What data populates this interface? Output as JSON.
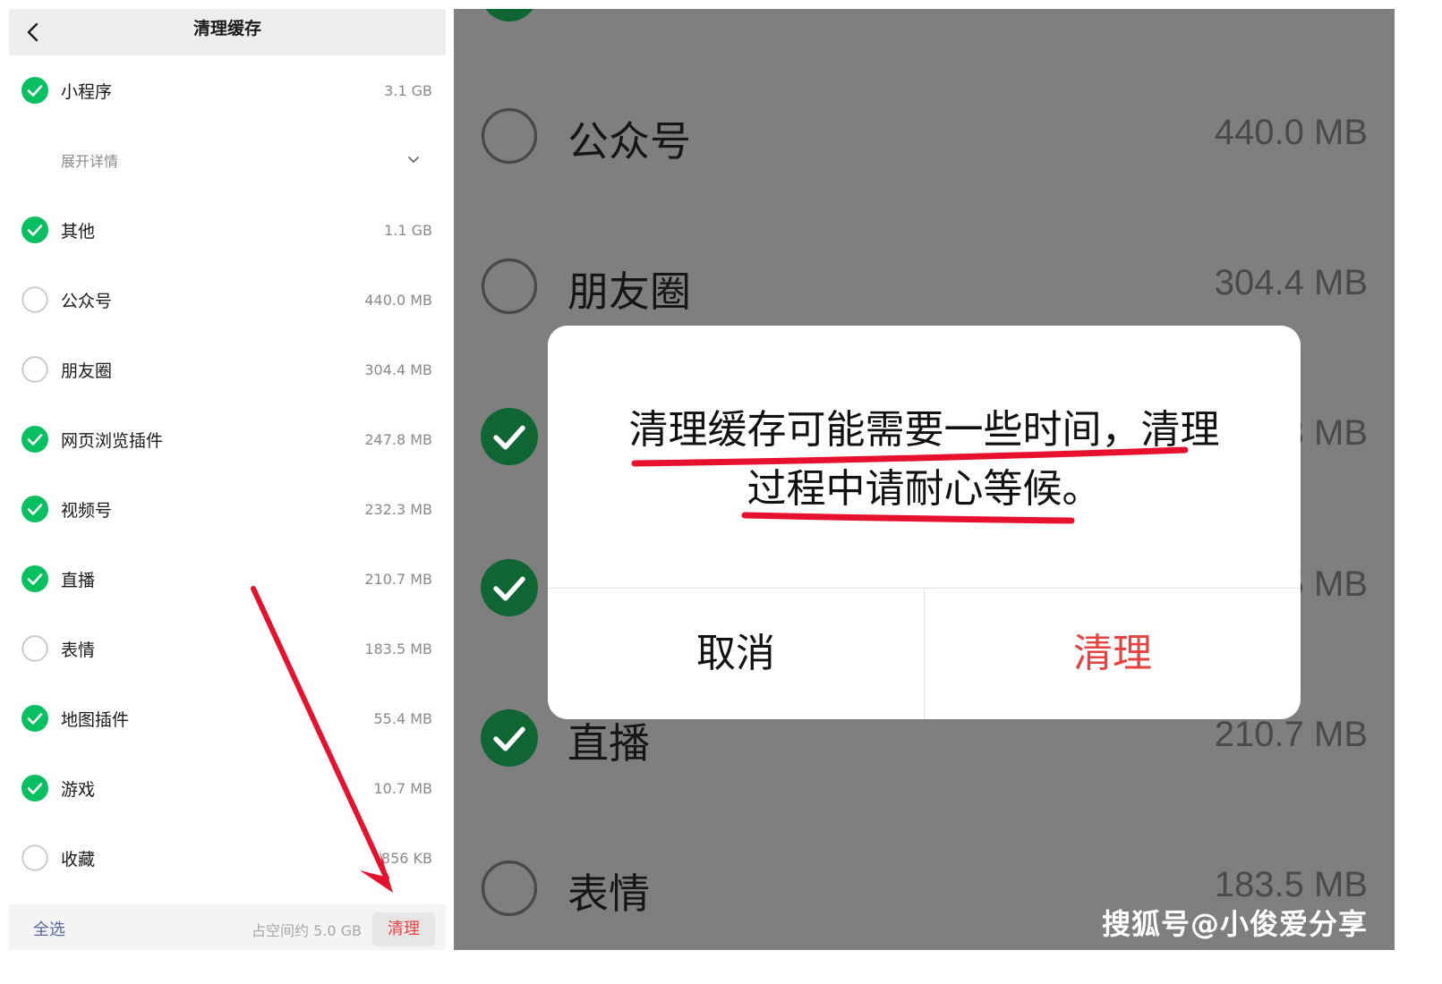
{
  "colors": {
    "check_green": "#07c160",
    "dim_check_green": "#0f6633",
    "accent_red": "#e64340",
    "link_blue": "#57699c",
    "overlay_gray": "#7f7f7f",
    "annotation_red": "#e8112d"
  },
  "left": {
    "title": "清理缓存",
    "back_icon": "chevron-left-icon",
    "expand_label": "展开详情",
    "items": [
      {
        "label": "小程序",
        "size": "3.1 GB",
        "checked": true
      },
      {
        "label": "其他",
        "size": "1.1 GB",
        "checked": true
      },
      {
        "label": "公众号",
        "size": "440.0 MB",
        "checked": false
      },
      {
        "label": "朋友圈",
        "size": "304.4 MB",
        "checked": false
      },
      {
        "label": "网页浏览插件",
        "size": "247.8 MB",
        "checked": true
      },
      {
        "label": "视频号",
        "size": "232.3 MB",
        "checked": true
      },
      {
        "label": "直播",
        "size": "210.7 MB",
        "checked": true
      },
      {
        "label": "表情",
        "size": "183.5 MB",
        "checked": false
      },
      {
        "label": "地图插件",
        "size": "55.4 MB",
        "checked": true
      },
      {
        "label": "游戏",
        "size": "10.7 MB",
        "checked": true
      },
      {
        "label": "收藏",
        "size": "856 KB",
        "checked": false
      }
    ],
    "footer": {
      "select_all": "全选",
      "space": "占空间约 5.0 GB",
      "clear": "清理"
    }
  },
  "right": {
    "rows": [
      {
        "label": "公众号",
        "size": "440.0 MB",
        "checked": false
      },
      {
        "label": "朋友圈",
        "size": "304.4 MB",
        "checked": false
      },
      {
        "label": "",
        "size": "3 MB",
        "checked": true
      },
      {
        "label": "",
        "size": "5 MB",
        "checked": true
      },
      {
        "label": "直播",
        "size": "210.7 MB",
        "checked": true
      },
      {
        "label": "表情",
        "size": "183.5 MB",
        "checked": false
      }
    ],
    "dialog": {
      "message_line1": "清理缓存可能需要一些时间，清理",
      "message_line2": "过程中请耐心等候。",
      "cancel": "取消",
      "confirm": "清理"
    },
    "watermark": "搜狐号@小俊爱分享"
  }
}
